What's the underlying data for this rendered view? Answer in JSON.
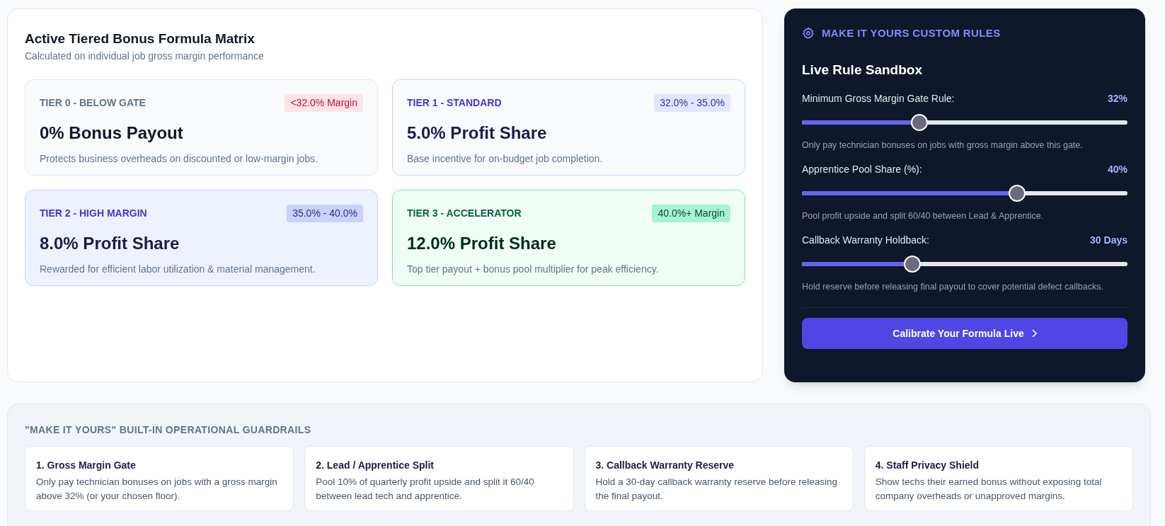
{
  "matrix": {
    "title": "Active Tiered Bonus Formula Matrix",
    "subtitle": "Calculated on individual job gross margin performance",
    "tiers": [
      {
        "kind": "below",
        "label": "TIER 0 - BELOW GATE",
        "badge": "<32.0% Margin",
        "headline": "0% Bonus Payout",
        "description": "Protects business overheads on discounted or low-margin jobs."
      },
      {
        "kind": "standard",
        "label": "TIER 1 - STANDARD",
        "badge": "32.0% - 35.0%",
        "headline": "5.0% Profit Share",
        "description": "Base incentive for on-budget job completion."
      },
      {
        "kind": "high",
        "label": "TIER 2 - HIGH MARGIN",
        "badge": "35.0% - 40.0%",
        "headline": "8.0% Profit Share",
        "description": "Rewarded for efficient labor utilization & material management."
      },
      {
        "kind": "accelerator",
        "label": "TIER 3 - ACCELERATOR",
        "badge": "40.0%+ Margin",
        "headline": "12.0% Profit Share",
        "description": "Top tier payout + bonus pool multiplier for peak efficiency."
      }
    ]
  },
  "sandbox": {
    "eyebrow": "MAKE IT YOURS CUSTOM RULES",
    "title": "Live Rule Sandbox",
    "sliders": [
      {
        "label": "Minimum Gross Margin Gate Rule:",
        "reading": "32%",
        "level": 0.36,
        "hint": "Only pay technician bonuses on jobs with gross margin above this gate."
      },
      {
        "label": "Apprentice Pool Share (%):",
        "reading": "40%",
        "level": 0.66,
        "hint": "Pool profit upside and split 60/40 between Lead & Apprentice."
      },
      {
        "label": "Callback Warranty Holdback:",
        "reading": "30 Days",
        "level": 0.34,
        "hint": "Hold reserve before releasing final payout to cover potential defect callbacks."
      }
    ],
    "button": "Calibrate Your Formula Live"
  },
  "guardrails": {
    "title": "\"MAKE IT YOURS\" BUILT-IN OPERATIONAL GUARDRAILS",
    "items": [
      {
        "title": "1. Gross Margin Gate",
        "text": "Only pay technician bonuses on jobs with a gross margin above 32% (or your chosen floor)."
      },
      {
        "title": "2. Lead / Apprentice Split",
        "text": "Pool 10% of quarterly profit upside and split it 60/40 between lead tech and apprentice."
      },
      {
        "title": "3. Callback Warranty Reserve",
        "text": "Hold a 30-day callback warranty reserve before releasing the final payout."
      },
      {
        "title": "4. Staff Privacy Shield",
        "text": "Show techs their earned bonus without exposing total company overheads or unapproved margins."
      }
    ]
  }
}
